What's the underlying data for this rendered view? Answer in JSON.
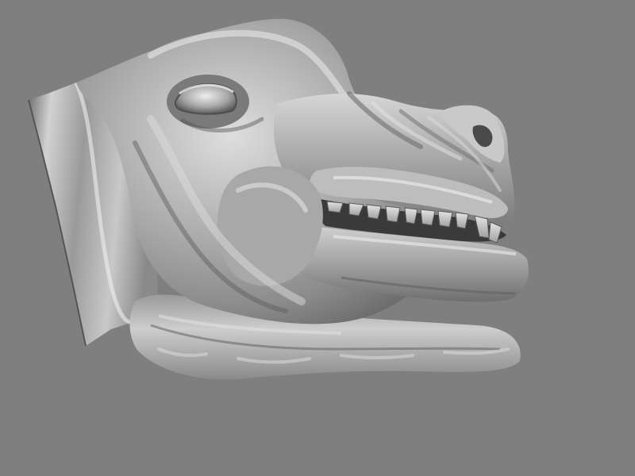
{
  "viewport": {
    "background": "#7f7f7f",
    "subject": "sculpted-animal-head-3d-model",
    "shading": "grey-phong"
  },
  "colors": {
    "highlight": "#e8e8e8",
    "midtone": "#b4b4b4",
    "shadow": "#5a5a5a",
    "deep_shadow": "#3e3e3e",
    "teeth": "#dcdcdc"
  }
}
